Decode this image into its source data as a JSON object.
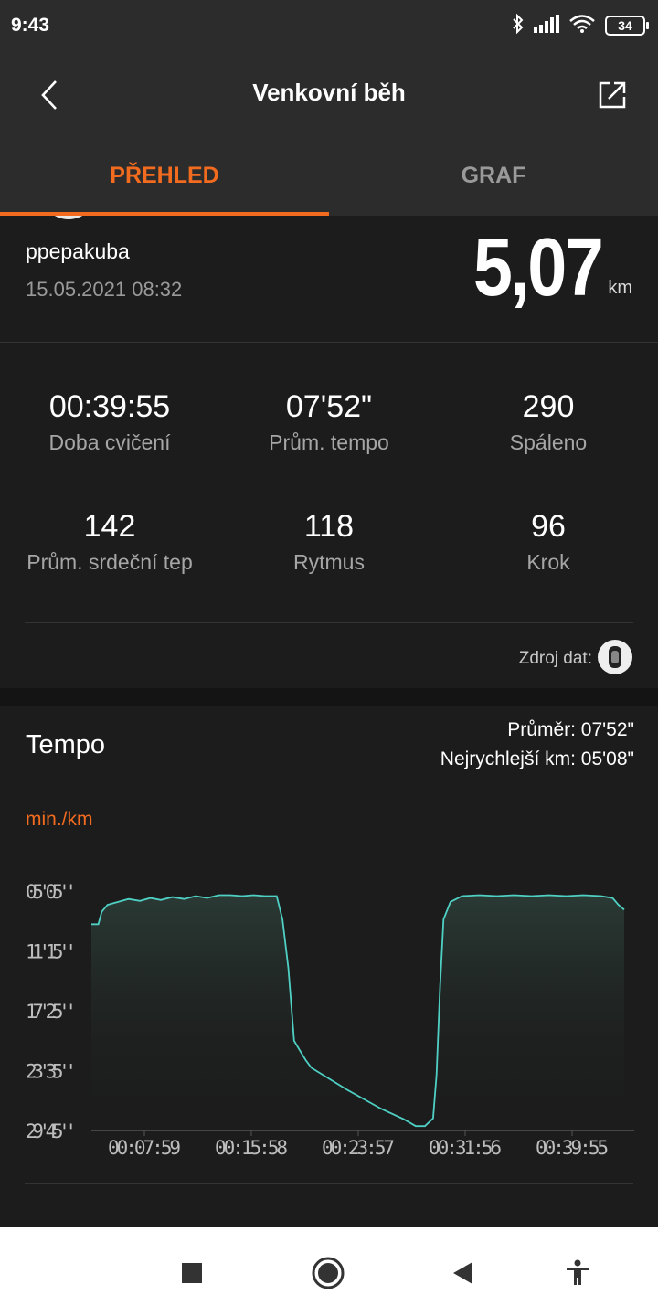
{
  "status_bar": {
    "time": "9:43",
    "battery": "34",
    "icons": [
      "bluetooth-icon",
      "signal-icon",
      "wifi-icon",
      "battery-icon"
    ]
  },
  "app_bar": {
    "title": "Venkovní běh",
    "back_icon": "chevron-left-icon",
    "share_icon": "share-icon"
  },
  "tabs": [
    {
      "label": "PŘEHLED",
      "active": true
    },
    {
      "label": "GRAF",
      "active": false
    }
  ],
  "summary": {
    "username": "ppepakuba",
    "datetime": "15.05.2021 08:32",
    "distance": "5,07",
    "distance_unit": "km",
    "stats": [
      {
        "value": "00:39:55",
        "label": "Doba cvičení"
      },
      {
        "value": "07'52\"",
        "label": "Prům. tempo"
      },
      {
        "value": "290",
        "label": "Spáleno"
      },
      {
        "value": "142",
        "label": "Prům. srdeční tep"
      },
      {
        "value": "118",
        "label": "Rytmus"
      },
      {
        "value": "96",
        "label": "Krok"
      }
    ],
    "data_source_label": "Zdroj dat:"
  },
  "tempo": {
    "title": "Tempo",
    "average": "Průměr: 07'52\"",
    "fastest_km": "Nejrychlejší km: 05'08\"",
    "unit": "min./km"
  },
  "chart_data": {
    "type": "area",
    "title": "Tempo",
    "ylabel": "min./km",
    "x_ticks": [
      "00:07:59",
      "00:15:58",
      "00:23:57",
      "00:31:56",
      "00:39:55"
    ],
    "y_ticks": [
      "05'05''",
      "11'15''",
      "17'25''",
      "23'35''",
      "29'45''"
    ],
    "ylim_minutes": [
      5.08,
      29.75
    ],
    "y_inverted": true,
    "xlim_minutes": [
      0,
      46
    ],
    "series": [
      {
        "line_color": "#4fd0c4",
        "x_minutes": [
          0,
          0.6,
          0.9,
          1.4,
          2.3,
          3.2,
          4.2,
          5.1,
          6.0,
          7.0,
          8.0,
          9.0,
          10.0,
          11.0,
          12.0,
          13.0,
          14.0,
          15.0,
          16.0,
          16.5,
          17.0,
          17.5,
          18.0,
          18.5,
          19.0,
          22.0,
          25.0,
          27.0,
          28.0,
          28.8,
          29.5,
          29.8,
          30.1,
          30.4,
          31.0,
          32.0,
          33.5,
          35.0,
          36.5,
          38.0,
          39.5,
          41.0,
          42.5,
          44.0,
          45.0,
          45.5,
          46.0
        ],
        "pace_minutes": [
          8.5,
          8.5,
          7.2,
          6.5,
          6.2,
          5.9,
          6.1,
          5.8,
          6.0,
          5.7,
          5.9,
          5.6,
          5.8,
          5.5,
          5.5,
          5.6,
          5.5,
          5.6,
          5.6,
          8.0,
          13.0,
          20.5,
          21.5,
          22.5,
          23.3,
          25.5,
          27.5,
          28.6,
          29.3,
          29.3,
          28.5,
          24.0,
          15.0,
          8.0,
          6.2,
          5.6,
          5.5,
          5.6,
          5.5,
          5.6,
          5.5,
          5.6,
          5.5,
          5.6,
          5.8,
          6.5,
          7.0
        ]
      }
    ]
  },
  "nav_bar": {
    "icons": [
      "square-icon",
      "home-circle-icon",
      "back-triangle-icon",
      "accessibility-icon"
    ]
  }
}
